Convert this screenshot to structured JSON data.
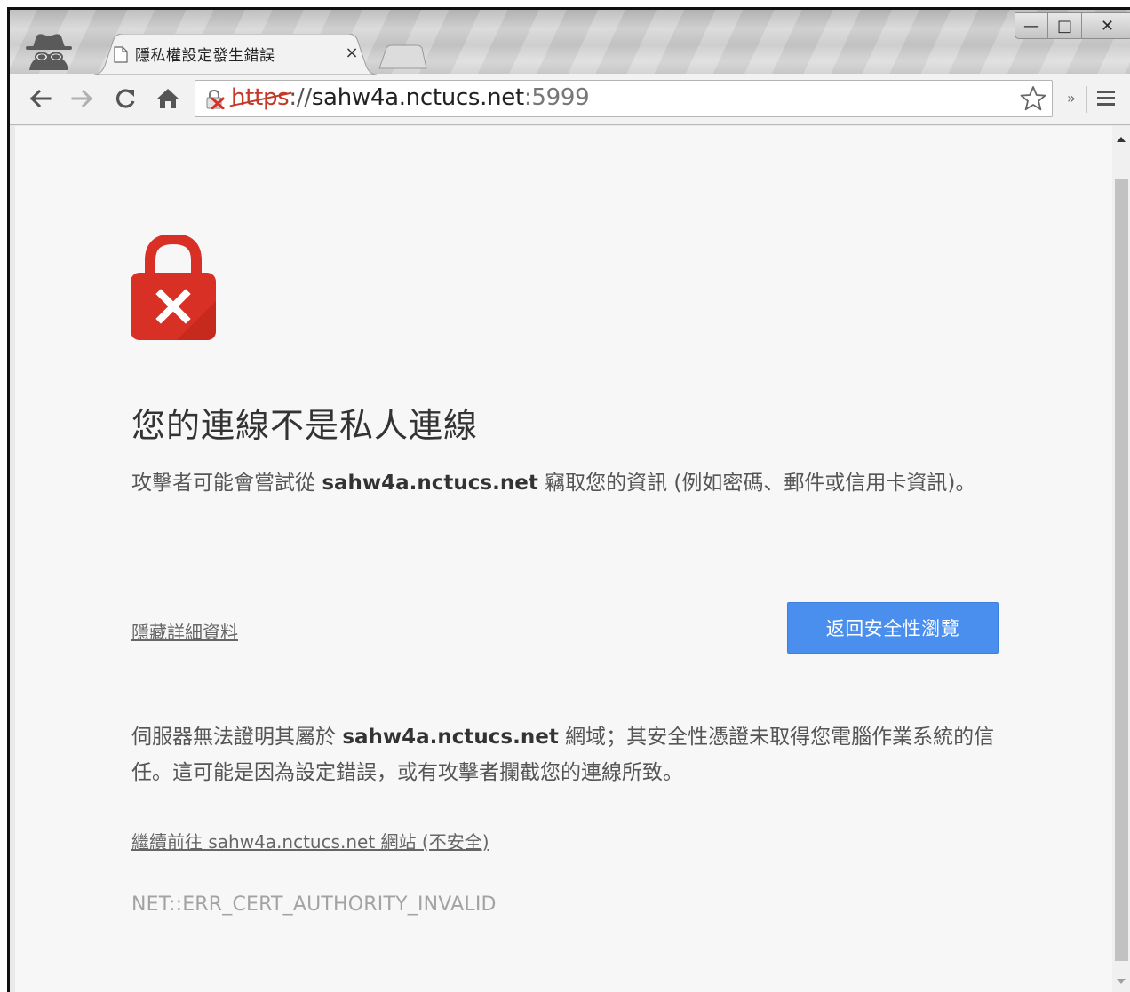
{
  "browser": {
    "tab": {
      "title": "隱私權設定發生錯誤",
      "close_glyph": "×"
    },
    "window_controls": {
      "minimize": "—",
      "maximize": "□",
      "close": "✕"
    },
    "address_bar": {
      "scheme": "https",
      "separator": "://",
      "host": "sahw4a.nctucs.net",
      "port": ":5999"
    },
    "overflow_glyph": "»",
    "icons": {
      "incognito": "incognito-icon",
      "back": "back-arrow-icon",
      "forward": "forward-arrow-icon",
      "reload": "reload-icon",
      "home": "home-icon",
      "security": "broken-lock-icon",
      "bookmark": "star-icon",
      "menu": "hamburger-menu-icon"
    }
  },
  "page": {
    "error_icon": "red-lock-x-icon",
    "heading": "您的連線不是私人連線",
    "intro": {
      "before": "攻擊者可能會嘗試從 ",
      "host": "sahw4a.nctucs.net",
      "after": " 竊取您的資訊 (例如密碼、郵件或信用卡資訊)。"
    },
    "details_link": "隱藏詳細資料",
    "back_button": "返回安全性瀏覽",
    "explanation": {
      "before": "伺服器無法證明其屬於 ",
      "host": "sahw4a.nctucs.net",
      "after": " 網域；其安全性憑證未取得您電腦作業系統的信任。這可能是因為設定錯誤，或有攻擊者攔截您的連線所致。"
    },
    "proceed_link": "繼續前往 sahw4a.nctucs.net 網站 (不安全)",
    "error_code": "NET::ERR_CERT_AUTHORITY_INVALID"
  },
  "colors": {
    "accent_blue": "#4a8eee",
    "error_red": "#d93025",
    "page_background": "#f7f7f7"
  }
}
